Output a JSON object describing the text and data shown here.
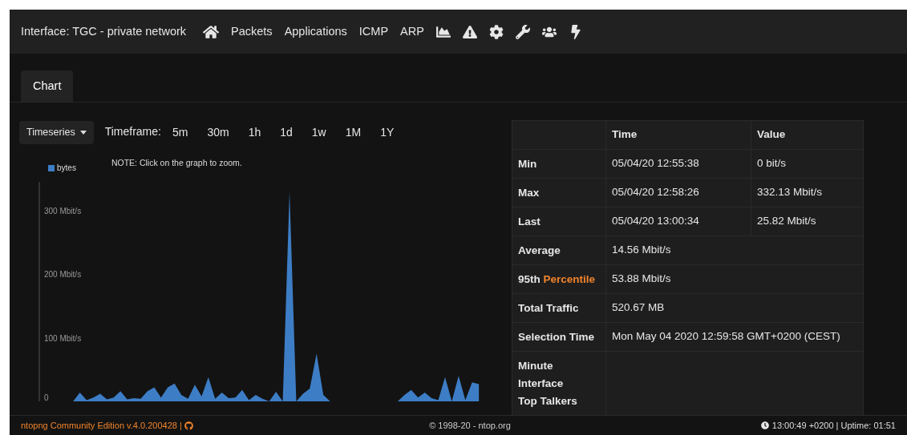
{
  "navbar": {
    "interface_label": "Interface: TGC - private network",
    "links": [
      "Packets",
      "Applications",
      "ICMP",
      "ARP"
    ]
  },
  "tabs": [
    {
      "label": "Chart",
      "selected": true
    }
  ],
  "toolbar": {
    "dropdown": "Timeseries",
    "timeframe_label": "Timeframe:",
    "timeframes": [
      "5m",
      "30m",
      "1h",
      "1d",
      "1w",
      "1M",
      "1Y"
    ]
  },
  "note": "NOTE: Click on the graph to zoom.",
  "chart": {
    "chart_data": {
      "type": "area",
      "ylim": [
        0,
        345
      ],
      "yticks": [
        {
          "value": 300,
          "label": "300 Mbit/s"
        },
        {
          "value": 200,
          "label": "200 Mbit/s"
        },
        {
          "value": 100,
          "label": "100 Mbit/s"
        },
        {
          "value": 0,
          "label": "0"
        }
      ],
      "series": [
        {
          "name": "bytes",
          "color": "#3d7dc5",
          "values": [
            0,
            0,
            0,
            0,
            0,
            0,
            14,
            2,
            6,
            12,
            3,
            6,
            16,
            3,
            5,
            4,
            16,
            22,
            6,
            22,
            28,
            10,
            4,
            26,
            8,
            38,
            4,
            14,
            5,
            6,
            18,
            2,
            10,
            4,
            0,
            15,
            0,
            330,
            0,
            12,
            20,
            75,
            10,
            0,
            0,
            0,
            0,
            0,
            0,
            0,
            0,
            0,
            0,
            0,
            10,
            18,
            6,
            14,
            5,
            2,
            38,
            0,
            40,
            2,
            30,
            27
          ]
        }
      ]
    }
  },
  "stats_table": {
    "columns": [
      "Time",
      "Value"
    ],
    "rows": [
      {
        "label": "Min",
        "time": "05/04/20 12:55:38",
        "value": "0 bit/s"
      },
      {
        "label": "Max",
        "time": "05/04/20 12:58:26",
        "value": "332.13 Mbit/s"
      },
      {
        "label": "Last",
        "time": "05/04/20 13:00:34",
        "value": "25.82 Mbit/s"
      },
      {
        "label": "Average",
        "value": "14.56 Mbit/s"
      },
      {
        "label": "95th",
        "label_accent": "Percentile",
        "value": "53.88 Mbit/s"
      },
      {
        "label": "Total Traffic",
        "value": "520.67 MB"
      },
      {
        "label": "Selection Time",
        "value": "Mon May 04 2020 12:59:58 GMT+0200 (CEST)"
      },
      {
        "label_lines": [
          "Minute",
          "Interface",
          "Top Talkers"
        ]
      }
    ]
  },
  "footer": {
    "edition": "ntopng Community Edition v.4.0.200428 |",
    "copyright": "© 1998-20 - ntop.org",
    "clock": "13:00:49 +0200 | Uptime: 01:51"
  }
}
